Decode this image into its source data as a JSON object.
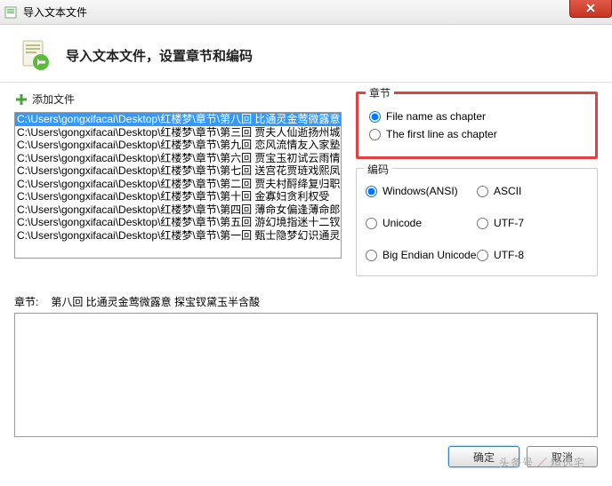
{
  "titlebar": {
    "title": "导入文本文件"
  },
  "header": {
    "title": "导入文本文件，设置章节和编码"
  },
  "add_file": {
    "label": "添加文件"
  },
  "file_list": {
    "items": [
      "C:\\Users\\gongxifacai\\Desktop\\红楼梦\\章节\\第八回 比通灵金莺微露意",
      "C:\\Users\\gongxifacai\\Desktop\\红楼梦\\章节\\第三回 贾夫人仙逝扬州城",
      "C:\\Users\\gongxifacai\\Desktop\\红楼梦\\章节\\第九回 恋风流情友入家塾",
      "C:\\Users\\gongxifacai\\Desktop\\红楼梦\\章节\\第六回 贾宝玉初试云雨情",
      "C:\\Users\\gongxifacai\\Desktop\\红楼梦\\章节\\第七回 送宫花贾琏戏熙凤",
      "C:\\Users\\gongxifacai\\Desktop\\红楼梦\\章节\\第二回 贾夫村酹绛复归职",
      "C:\\Users\\gongxifacai\\Desktop\\红楼梦\\章节\\第十回    金寡妇贪利权受",
      "C:\\Users\\gongxifacai\\Desktop\\红楼梦\\章节\\第四回 薄命女偏逢薄命郎",
      "C:\\Users\\gongxifacai\\Desktop\\红楼梦\\章节\\第五回 游幻境指迷十二钗",
      "C:\\Users\\gongxifacai\\Desktop\\红楼梦\\章节\\第一回 甄士隐梦幻识通灵"
    ],
    "selected_index": 0
  },
  "chapter_group": {
    "title": "章节",
    "opt1": "File name as chapter",
    "opt2": "The first line as chapter"
  },
  "encoding_group": {
    "title": "编码",
    "opt1": "Windows(ANSI)",
    "opt2": "ASCII",
    "opt3": "Unicode",
    "opt4": "UTF-7",
    "opt5": "Big Endian Unicode",
    "opt6": "UTF-8"
  },
  "chapter_row": {
    "label": "章节:",
    "value": "第八回 比通灵金莺微露意    探宝钗黛玉半含酸"
  },
  "footer": {
    "ok": "确定",
    "cancel": "取消"
  },
  "watermark": {
    "brand": "头条号",
    "author": "精选宅"
  }
}
